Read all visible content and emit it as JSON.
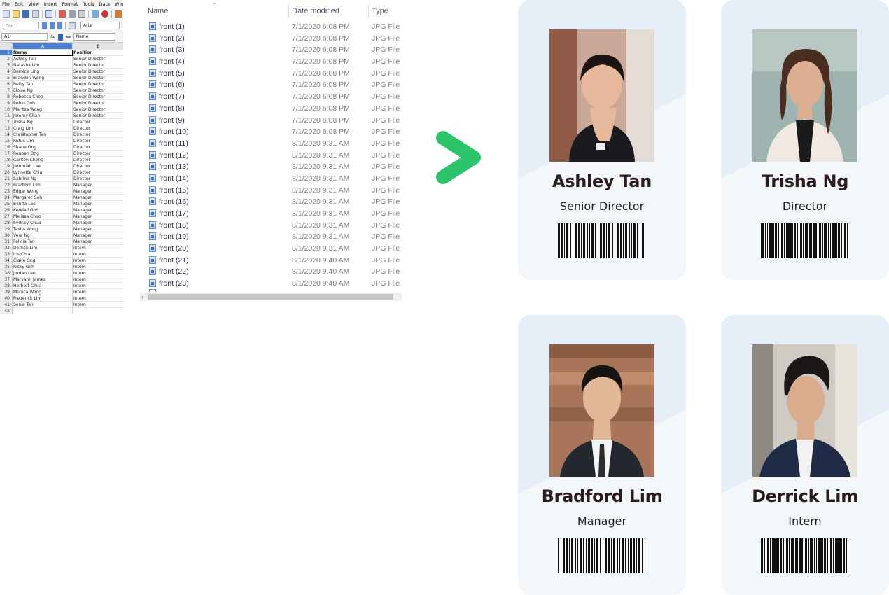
{
  "spreadsheet": {
    "menu": [
      "File",
      "Edit",
      "View",
      "Insert",
      "Format",
      "Tools",
      "Data",
      "Window"
    ],
    "find_placeholder": "Find",
    "font_name": "Arial",
    "name_box": "A1",
    "formula_value": "Name",
    "column_headers": [
      "A",
      "B"
    ],
    "rows": [
      {
        "n": "1",
        "a": "Name",
        "b": "Position"
      },
      {
        "n": "2",
        "a": "Ashley Tan",
        "b": "Senior Director"
      },
      {
        "n": "3",
        "a": "Natasha Lim",
        "b": "Senior Director"
      },
      {
        "n": "4",
        "a": "Bernice Ling",
        "b": "Senior Director"
      },
      {
        "n": "5",
        "a": "Brandon Wong",
        "b": "Senior Director"
      },
      {
        "n": "6",
        "a": "Betty Tan",
        "b": "Senior Director"
      },
      {
        "n": "7",
        "a": "Eloise Ng",
        "b": "Senior Director"
      },
      {
        "n": "8",
        "a": "Rebecca Choo",
        "b": "Senior Director"
      },
      {
        "n": "9",
        "a": "Robin Goh",
        "b": "Senior Director"
      },
      {
        "n": "10",
        "a": "Maritza Wong",
        "b": "Senior Director"
      },
      {
        "n": "11",
        "a": "Jeremy Chan",
        "b": "Senior Director"
      },
      {
        "n": "12",
        "a": "Trisha Ng",
        "b": "Director"
      },
      {
        "n": "13",
        "a": "Craig Lim",
        "b": "Director"
      },
      {
        "n": "14",
        "a": "Christopher Tan",
        "b": "Director"
      },
      {
        "n": "15",
        "a": "Rufus Lim",
        "b": "Director"
      },
      {
        "n": "16",
        "a": "Shane Ong",
        "b": "Director"
      },
      {
        "n": "17",
        "a": "Reuben Ong",
        "b": "Director"
      },
      {
        "n": "18",
        "a": "Carlton Cheng",
        "b": "Director"
      },
      {
        "n": "19",
        "a": "Jeremiah Lee",
        "b": "Director"
      },
      {
        "n": "20",
        "a": "Lynnette Chia",
        "b": "Director"
      },
      {
        "n": "21",
        "a": "Sabrina Ng",
        "b": "Director"
      },
      {
        "n": "22",
        "a": "Bradford Lim",
        "b": "Manager"
      },
      {
        "n": "23",
        "a": "Edgar Wong",
        "b": "Manager"
      },
      {
        "n": "24",
        "a": "Margaret Goh",
        "b": "Manager"
      },
      {
        "n": "25",
        "a": "Benita Lee",
        "b": "Manager"
      },
      {
        "n": "26",
        "a": "Kendall Goh",
        "b": "Manager"
      },
      {
        "n": "27",
        "a": "Melissa Choo",
        "b": "Manager"
      },
      {
        "n": "28",
        "a": "Sydney Chua",
        "b": "Manager"
      },
      {
        "n": "29",
        "a": "Tasha Wong",
        "b": "Manager"
      },
      {
        "n": "30",
        "a": "Vera Ng",
        "b": "Manager"
      },
      {
        "n": "31",
        "a": "Felicia Tan",
        "b": "Manager"
      },
      {
        "n": "32",
        "a": "Derrick Lim",
        "b": "Intern"
      },
      {
        "n": "33",
        "a": "Iris Chia",
        "b": "Intern"
      },
      {
        "n": "34",
        "a": "Claire Ong",
        "b": "Intern"
      },
      {
        "n": "35",
        "a": "Ricky Goh",
        "b": "Intern"
      },
      {
        "n": "36",
        "a": "Jordan Lee",
        "b": "Intern"
      },
      {
        "n": "37",
        "a": "Maryann James",
        "b": "Intern"
      },
      {
        "n": "38",
        "a": "Herbert Chua",
        "b": "Intern"
      },
      {
        "n": "39",
        "a": "Monica Wong",
        "b": "Intern"
      },
      {
        "n": "40",
        "a": "Frederick Lim",
        "b": "Intern"
      },
      {
        "n": "41",
        "a": "Sonia Tan",
        "b": "Intern"
      },
      {
        "n": "42",
        "a": "",
        "b": ""
      }
    ]
  },
  "explorer": {
    "columns": {
      "name": "Name",
      "date": "Date modified",
      "type": "Type"
    },
    "files": [
      {
        "name": "front (1)",
        "date": "7/1/2020 6:08 PM",
        "type": "JPG File"
      },
      {
        "name": "front (2)",
        "date": "7/1/2020 6:08 PM",
        "type": "JPG File"
      },
      {
        "name": "front (3)",
        "date": "7/1/2020 6:08 PM",
        "type": "JPG File"
      },
      {
        "name": "front (4)",
        "date": "7/1/2020 6:08 PM",
        "type": "JPG File"
      },
      {
        "name": "front (5)",
        "date": "7/1/2020 6:08 PM",
        "type": "JPG File"
      },
      {
        "name": "front (6)",
        "date": "7/1/2020 6:08 PM",
        "type": "JPG File"
      },
      {
        "name": "front (7)",
        "date": "7/1/2020 6:08 PM",
        "type": "JPG File"
      },
      {
        "name": "front (8)",
        "date": "7/1/2020 6:08 PM",
        "type": "JPG File"
      },
      {
        "name": "front (9)",
        "date": "7/1/2020 6:08 PM",
        "type": "JPG File"
      },
      {
        "name": "front (10)",
        "date": "7/1/2020 6:08 PM",
        "type": "JPG File"
      },
      {
        "name": "front (11)",
        "date": "8/1/2020 9:31 AM",
        "type": "JPG File"
      },
      {
        "name": "front (12)",
        "date": "8/1/2020 9:31 AM",
        "type": "JPG File"
      },
      {
        "name": "front (13)",
        "date": "8/1/2020 9:31 AM",
        "type": "JPG File"
      },
      {
        "name": "front (14)",
        "date": "8/1/2020 9:31 AM",
        "type": "JPG File"
      },
      {
        "name": "front (15)",
        "date": "8/1/2020 9:31 AM",
        "type": "JPG File"
      },
      {
        "name": "front (16)",
        "date": "8/1/2020 9:31 AM",
        "type": "JPG File"
      },
      {
        "name": "front (17)",
        "date": "8/1/2020 9:31 AM",
        "type": "JPG File"
      },
      {
        "name": "front (18)",
        "date": "8/1/2020 9:31 AM",
        "type": "JPG File"
      },
      {
        "name": "front (19)",
        "date": "8/1/2020 9:31 AM",
        "type": "JPG File"
      },
      {
        "name": "front (20)",
        "date": "8/1/2020 9:31 AM",
        "type": "JPG File"
      },
      {
        "name": "front (21)",
        "date": "8/1/2020 9:40 AM",
        "type": "JPG File"
      },
      {
        "name": "front (22)",
        "date": "8/1/2020 9:40 AM",
        "type": "JPG File"
      },
      {
        "name": "front (23)",
        "date": "8/1/2020 9:40 AM",
        "type": "JPG File"
      }
    ]
  },
  "arrow_color": "#2cc36b",
  "cards": [
    {
      "name": "Ashley Tan",
      "role": "Senior Director",
      "photo": "woman-portrait-photo"
    },
    {
      "name": "Trisha Ng",
      "role": "Director",
      "photo": "woman-portrait-photo"
    },
    {
      "name": "Bradford Lim",
      "role": "Manager",
      "photo": "man-portrait-photo"
    },
    {
      "name": "Derrick Lim",
      "role": "Intern",
      "photo": "man-portrait-photo"
    }
  ]
}
